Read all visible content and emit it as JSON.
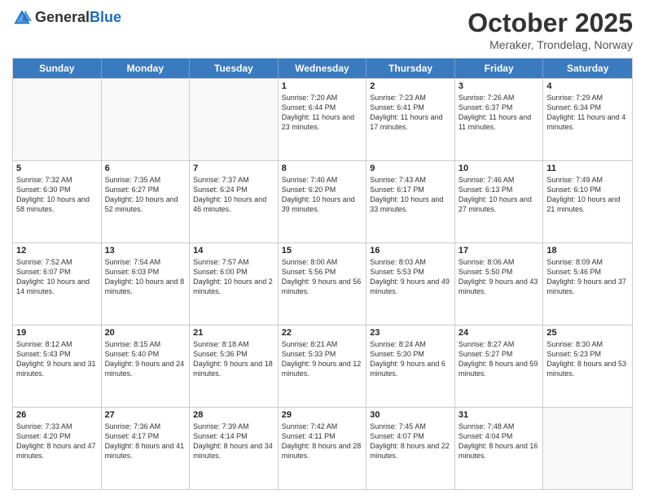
{
  "logo": {
    "general": "General",
    "blue": "Blue"
  },
  "header": {
    "month": "October 2025",
    "location": "Meraker, Trondelag, Norway"
  },
  "days": [
    "Sunday",
    "Monday",
    "Tuesday",
    "Wednesday",
    "Thursday",
    "Friday",
    "Saturday"
  ],
  "rows": [
    [
      {
        "day": "",
        "empty": true
      },
      {
        "day": "",
        "empty": true
      },
      {
        "day": "",
        "empty": true
      },
      {
        "day": "1",
        "sunrise": "7:20 AM",
        "sunset": "6:44 PM",
        "daylight": "11 hours and 23 minutes."
      },
      {
        "day": "2",
        "sunrise": "7:23 AM",
        "sunset": "6:41 PM",
        "daylight": "11 hours and 17 minutes."
      },
      {
        "day": "3",
        "sunrise": "7:26 AM",
        "sunset": "6:37 PM",
        "daylight": "11 hours and 11 minutes."
      },
      {
        "day": "4",
        "sunrise": "7:29 AM",
        "sunset": "6:34 PM",
        "daylight": "11 hours and 4 minutes."
      }
    ],
    [
      {
        "day": "5",
        "sunrise": "7:32 AM",
        "sunset": "6:30 PM",
        "daylight": "10 hours and 58 minutes."
      },
      {
        "day": "6",
        "sunrise": "7:35 AM",
        "sunset": "6:27 PM",
        "daylight": "10 hours and 52 minutes."
      },
      {
        "day": "7",
        "sunrise": "7:37 AM",
        "sunset": "6:24 PM",
        "daylight": "10 hours and 46 minutes."
      },
      {
        "day": "8",
        "sunrise": "7:40 AM",
        "sunset": "6:20 PM",
        "daylight": "10 hours and 39 minutes."
      },
      {
        "day": "9",
        "sunrise": "7:43 AM",
        "sunset": "6:17 PM",
        "daylight": "10 hours and 33 minutes."
      },
      {
        "day": "10",
        "sunrise": "7:46 AM",
        "sunset": "6:13 PM",
        "daylight": "10 hours and 27 minutes."
      },
      {
        "day": "11",
        "sunrise": "7:49 AM",
        "sunset": "6:10 PM",
        "daylight": "10 hours and 21 minutes."
      }
    ],
    [
      {
        "day": "12",
        "sunrise": "7:52 AM",
        "sunset": "6:07 PM",
        "daylight": "10 hours and 14 minutes."
      },
      {
        "day": "13",
        "sunrise": "7:54 AM",
        "sunset": "6:03 PM",
        "daylight": "10 hours and 8 minutes."
      },
      {
        "day": "14",
        "sunrise": "7:57 AM",
        "sunset": "6:00 PM",
        "daylight": "10 hours and 2 minutes."
      },
      {
        "day": "15",
        "sunrise": "8:00 AM",
        "sunset": "5:56 PM",
        "daylight": "9 hours and 56 minutes."
      },
      {
        "day": "16",
        "sunrise": "8:03 AM",
        "sunset": "5:53 PM",
        "daylight": "9 hours and 49 minutes."
      },
      {
        "day": "17",
        "sunrise": "8:06 AM",
        "sunset": "5:50 PM",
        "daylight": "9 hours and 43 minutes."
      },
      {
        "day": "18",
        "sunrise": "8:09 AM",
        "sunset": "5:46 PM",
        "daylight": "9 hours and 37 minutes."
      }
    ],
    [
      {
        "day": "19",
        "sunrise": "8:12 AM",
        "sunset": "5:43 PM",
        "daylight": "9 hours and 31 minutes."
      },
      {
        "day": "20",
        "sunrise": "8:15 AM",
        "sunset": "5:40 PM",
        "daylight": "9 hours and 24 minutes."
      },
      {
        "day": "21",
        "sunrise": "8:18 AM",
        "sunset": "5:36 PM",
        "daylight": "9 hours and 18 minutes."
      },
      {
        "day": "22",
        "sunrise": "8:21 AM",
        "sunset": "5:33 PM",
        "daylight": "9 hours and 12 minutes."
      },
      {
        "day": "23",
        "sunrise": "8:24 AM",
        "sunset": "5:30 PM",
        "daylight": "9 hours and 6 minutes."
      },
      {
        "day": "24",
        "sunrise": "8:27 AM",
        "sunset": "5:27 PM",
        "daylight": "8 hours and 59 minutes."
      },
      {
        "day": "25",
        "sunrise": "8:30 AM",
        "sunset": "5:23 PM",
        "daylight": "8 hours and 53 minutes."
      }
    ],
    [
      {
        "day": "26",
        "sunrise": "7:33 AM",
        "sunset": "4:20 PM",
        "daylight": "8 hours and 47 minutes."
      },
      {
        "day": "27",
        "sunrise": "7:36 AM",
        "sunset": "4:17 PM",
        "daylight": "8 hours and 41 minutes."
      },
      {
        "day": "28",
        "sunrise": "7:39 AM",
        "sunset": "4:14 PM",
        "daylight": "8 hours and 34 minutes."
      },
      {
        "day": "29",
        "sunrise": "7:42 AM",
        "sunset": "4:11 PM",
        "daylight": "8 hours and 28 minutes."
      },
      {
        "day": "30",
        "sunrise": "7:45 AM",
        "sunset": "4:07 PM",
        "daylight": "8 hours and 22 minutes."
      },
      {
        "day": "31",
        "sunrise": "7:48 AM",
        "sunset": "4:04 PM",
        "daylight": "8 hours and 16 minutes."
      },
      {
        "day": "",
        "empty": true
      }
    ]
  ]
}
